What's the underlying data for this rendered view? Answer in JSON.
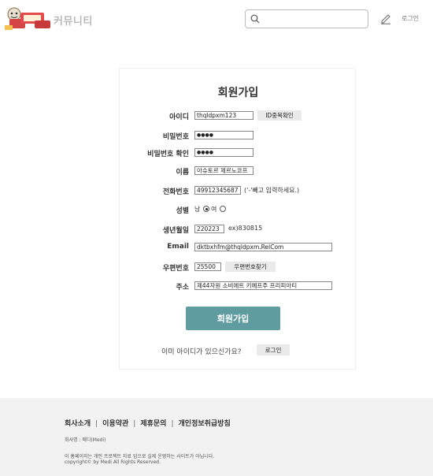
{
  "header": {
    "site_name": "커뮤니티",
    "search": {
      "placeholder": "",
      "value": ""
    },
    "login_label": "로그인"
  },
  "form": {
    "title": "회원가입",
    "fields": {
      "id": {
        "label": "아이디",
        "value": "thqldpxm123",
        "button": "ID중복확인"
      },
      "password": {
        "label": "비밀번호",
        "value": "●●●●"
      },
      "password_confirm": {
        "label": "비밀번호 확인",
        "value": "●●●●"
      },
      "name": {
        "label": "이름",
        "value": "아슈토르 제르노코프"
      },
      "phone": {
        "label": "전화번호",
        "value": "49912345687",
        "hint": "('-'빼고 입력하세요.)"
      },
      "gender": {
        "label": "성별",
        "male": "남",
        "female": "여",
        "selected": "남"
      },
      "birth": {
        "label": "생년월일",
        "value": "220223",
        "hint": "ex)830815"
      },
      "email": {
        "label": "Email",
        "value": "dktbxhfm@thqldpxm.RelCom"
      },
      "zipcode": {
        "label": "우편번호",
        "value": "25500",
        "button": "우편번호찾기"
      },
      "address": {
        "label": "주소",
        "value": "제44자원 소비에트 키예프주 프리피아티"
      }
    },
    "submit_label": "회원가입",
    "have_account_text": "이미 아이디가 있으신가요?",
    "login_button": "로그인"
  },
  "footer": {
    "links": [
      "회사소개",
      "이용약관",
      "제휴문의",
      "개인정보취급방침"
    ],
    "company": "회사명 : 메디(Medi)",
    "notice": "이 홈페이지는 개인 프로젝트 자료 임으로 실제 운영하는 사이트가 아닙니다.",
    "copyright": "copyright© by Medi All Rights Reserved."
  },
  "colors": {
    "accent": "#5e9ca0",
    "footer_bg": "#f2f2f2"
  },
  "icons": {
    "search": "search-icon",
    "pencil": "pencil-icon",
    "logo": "medi-logo"
  }
}
